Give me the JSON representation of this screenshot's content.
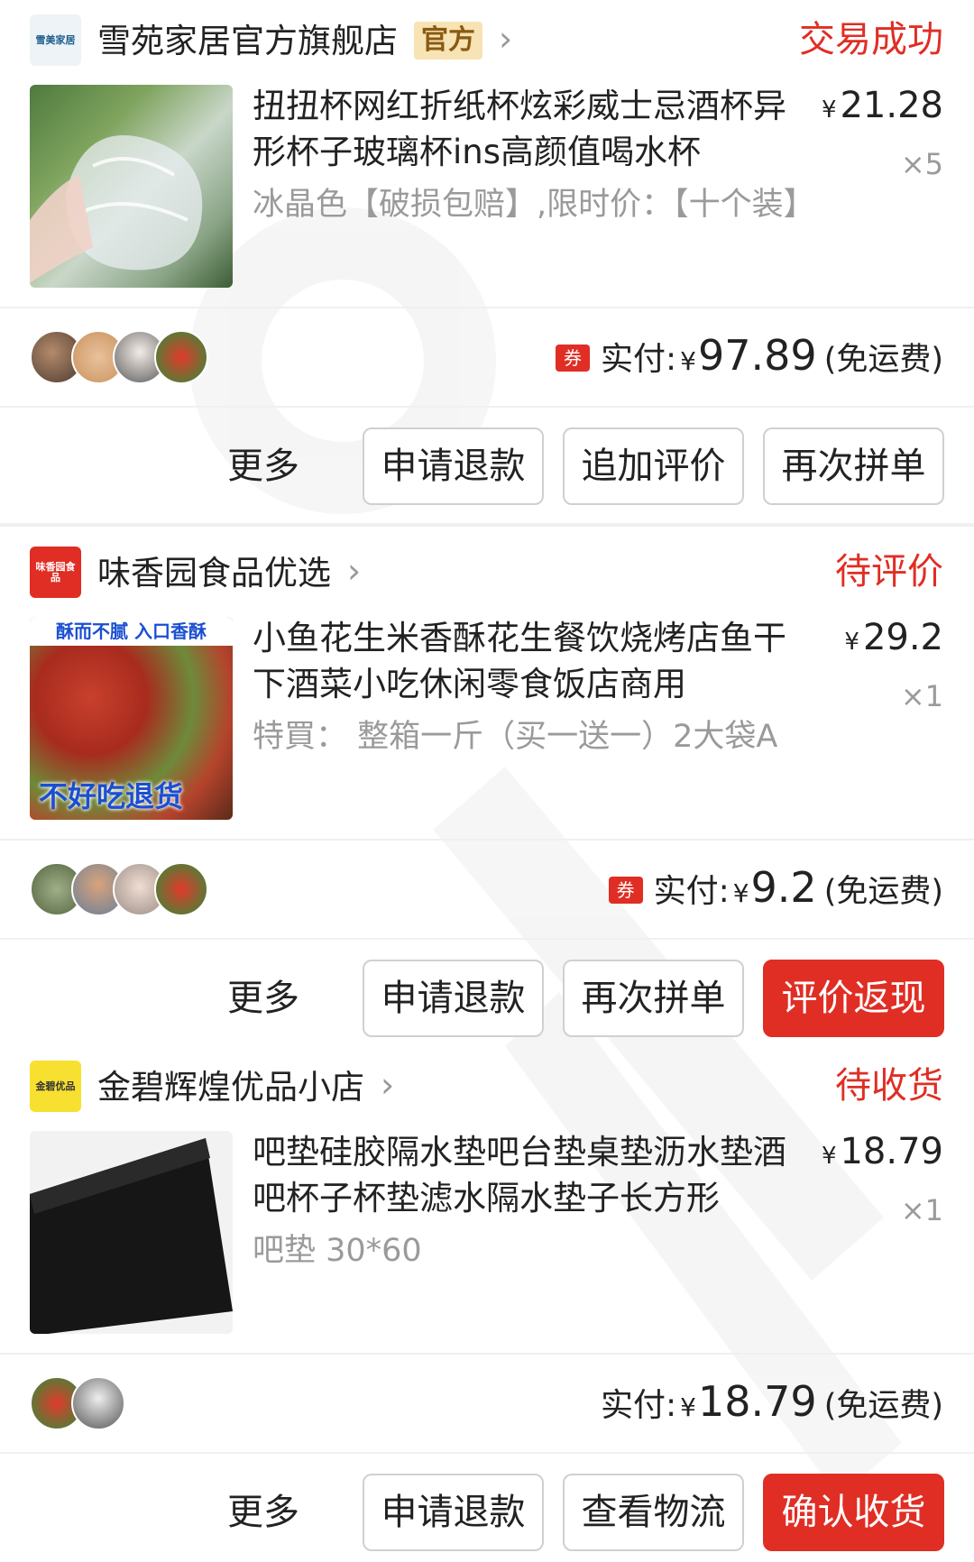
{
  "orders": [
    {
      "store_logo_text": "雪美家居",
      "store_name": "雪苑家居官方旗舰店",
      "store_badge": "官方",
      "status": "交易成功",
      "product_title": "扭扭杯网红折纸杯炫彩威士忌酒杯异形杯子玻璃杯ins高颜值喝水杯",
      "product_spec": "冰晶色【破损包赔】,限时价：【十个装】",
      "currency": "¥",
      "price": "21.28",
      "quantity": "×5",
      "coupon_label": "券",
      "paid_label": "实付:",
      "paid_amount": "97.89",
      "shipping_note": "(免运费)",
      "more_label": "更多",
      "buttons": [
        "申请退款",
        "追加评价",
        "再次拼单"
      ]
    },
    {
      "store_logo_text": "味香园食品",
      "store_name": "味香园食品优选",
      "status": "待评价",
      "thumb_top_text": "酥而不腻 入口香酥",
      "thumb_bottom_text": "不好吃退货",
      "product_title": "小鱼花生米香酥花生餐饮烧烤店鱼干下酒菜小吃休闲零食饭店商用",
      "product_spec": "特買：  整箱一斤（买一送一）2大袋A",
      "currency": "¥",
      "price": "29.2",
      "quantity": "×1",
      "coupon_label": "券",
      "paid_label": "实付:",
      "paid_amount": "9.2",
      "shipping_note": "(免运费)",
      "more_label": "更多",
      "buttons": [
        "申请退款",
        "再次拼单",
        "评价返现"
      ]
    },
    {
      "store_logo_text": "金碧优品",
      "store_name": "金碧辉煌优品小店",
      "status": "待收货",
      "product_title": "吧垫硅胶隔水垫吧台垫桌垫沥水垫酒吧杯子杯垫滤水隔水垫子长方形",
      "product_spec": "吧垫 30*60",
      "currency": "¥",
      "price": "18.79",
      "quantity": "×1",
      "paid_label": "实付:",
      "paid_amount": "18.79",
      "shipping_note": "(免运费)",
      "more_label": "更多",
      "buttons": [
        "申请退款",
        "查看物流",
        "确认收货"
      ]
    }
  ],
  "colors": {
    "accent": "#e02e24",
    "badge_bg": "#f7e3b4",
    "muted": "#9a9a9a"
  }
}
